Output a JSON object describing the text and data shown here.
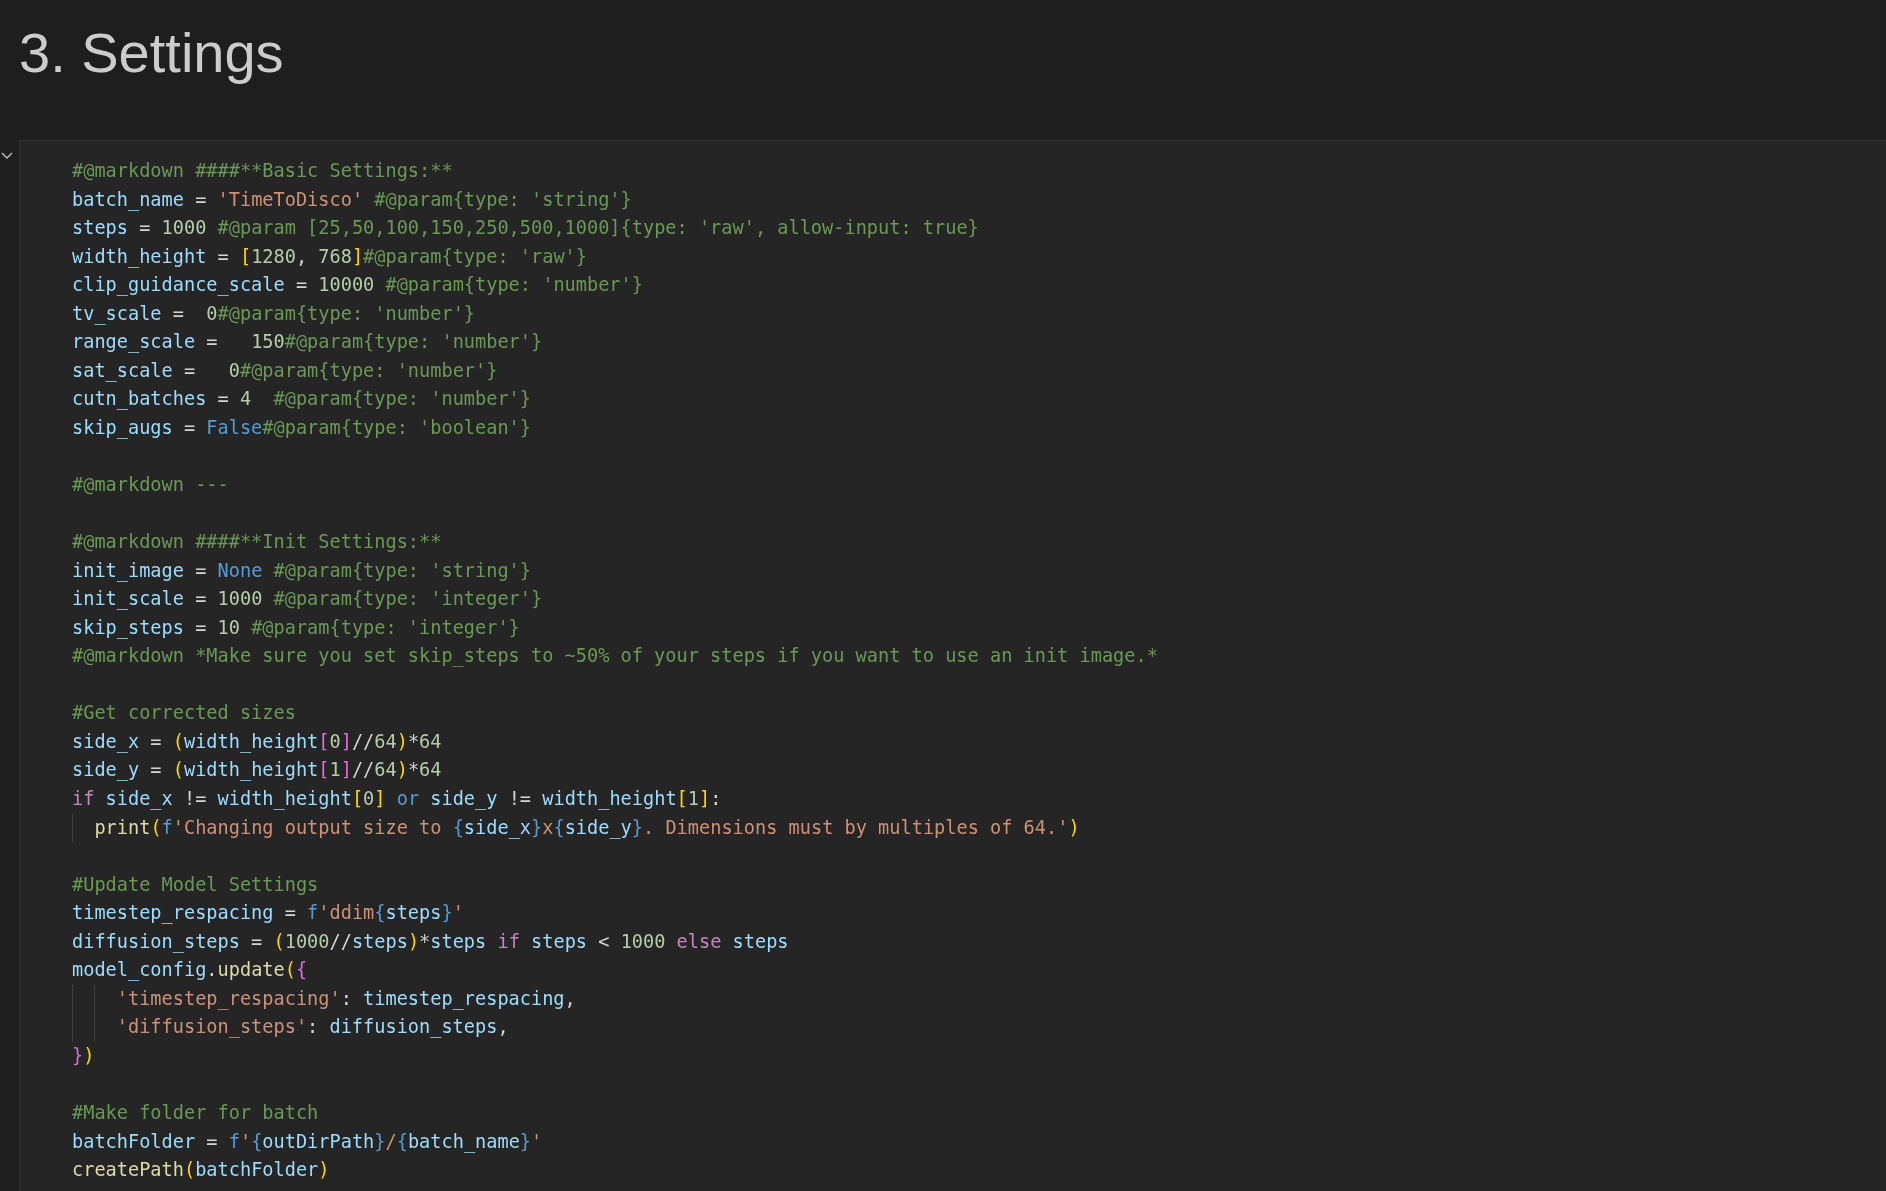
{
  "heading": "3. Settings",
  "cell": {
    "expanded": true,
    "lines": [
      {
        "kind": "code",
        "tokens": [
          {
            "text": "#@markdown ####**Basic Settings:**",
            "kind": "comment"
          }
        ]
      },
      {
        "kind": "code",
        "tokens": [
          {
            "text": "batch_name",
            "kind": "var"
          },
          {
            "text": " = ",
            "kind": "op"
          },
          {
            "text": "'TimeToDisco'",
            "kind": "str"
          },
          {
            "text": " #@param{type: 'string'}",
            "kind": "comment"
          }
        ]
      },
      {
        "kind": "code",
        "tokens": [
          {
            "text": "steps",
            "kind": "var"
          },
          {
            "text": " = ",
            "kind": "op"
          },
          {
            "text": "1000",
            "kind": "num"
          },
          {
            "text": " #@param [25,50,100,150,250,500,1000]{type: 'raw', allow-input: true}",
            "kind": "comment"
          }
        ]
      },
      {
        "kind": "code",
        "tokens": [
          {
            "text": "width_height",
            "kind": "var"
          },
          {
            "text": " = ",
            "kind": "op"
          },
          {
            "text": "[",
            "kind": "b1"
          },
          {
            "text": "1280",
            "kind": "num"
          },
          {
            "text": ", ",
            "kind": "op"
          },
          {
            "text": "768",
            "kind": "num"
          },
          {
            "text": "]",
            "kind": "b1"
          },
          {
            "text": "#@param{type: 'raw'}",
            "kind": "comment"
          }
        ]
      },
      {
        "kind": "code",
        "tokens": [
          {
            "text": "clip_guidance_scale",
            "kind": "var"
          },
          {
            "text": " = ",
            "kind": "op"
          },
          {
            "text": "10000",
            "kind": "num"
          },
          {
            "text": " #@param{type: 'number'}",
            "kind": "comment"
          }
        ]
      },
      {
        "kind": "code",
        "tokens": [
          {
            "text": "tv_scale",
            "kind": "var"
          },
          {
            "text": " =  ",
            "kind": "op"
          },
          {
            "text": "0",
            "kind": "num"
          },
          {
            "text": "#@param{type: 'number'}",
            "kind": "comment"
          }
        ]
      },
      {
        "kind": "code",
        "tokens": [
          {
            "text": "range_scale",
            "kind": "var"
          },
          {
            "text": " =   ",
            "kind": "op"
          },
          {
            "text": "150",
            "kind": "num"
          },
          {
            "text": "#@param{type: 'number'}",
            "kind": "comment"
          }
        ]
      },
      {
        "kind": "code",
        "tokens": [
          {
            "text": "sat_scale",
            "kind": "var"
          },
          {
            "text": " =   ",
            "kind": "op"
          },
          {
            "text": "0",
            "kind": "num"
          },
          {
            "text": "#@param{type: 'number'}",
            "kind": "comment"
          }
        ]
      },
      {
        "kind": "code",
        "tokens": [
          {
            "text": "cutn_batches",
            "kind": "var"
          },
          {
            "text": " = ",
            "kind": "op"
          },
          {
            "text": "4",
            "kind": "num"
          },
          {
            "text": "  #@param{type: 'number'}",
            "kind": "comment"
          }
        ]
      },
      {
        "kind": "code",
        "tokens": [
          {
            "text": "skip_augs",
            "kind": "var"
          },
          {
            "text": " = ",
            "kind": "op"
          },
          {
            "text": "False",
            "kind": "kw"
          },
          {
            "text": "#@param{type: 'boolean'}",
            "kind": "comment"
          }
        ]
      },
      {
        "kind": "blank"
      },
      {
        "kind": "code",
        "tokens": [
          {
            "text": "#@markdown ---",
            "kind": "comment"
          }
        ]
      },
      {
        "kind": "blank"
      },
      {
        "kind": "code",
        "tokens": [
          {
            "text": "#@markdown ####**Init Settings:**",
            "kind": "comment"
          }
        ]
      },
      {
        "kind": "code",
        "tokens": [
          {
            "text": "init_image",
            "kind": "var"
          },
          {
            "text": " = ",
            "kind": "op"
          },
          {
            "text": "None",
            "kind": "kw"
          },
          {
            "text": " #@param{type: 'string'}",
            "kind": "comment"
          }
        ]
      },
      {
        "kind": "code",
        "tokens": [
          {
            "text": "init_scale",
            "kind": "var"
          },
          {
            "text": " = ",
            "kind": "op"
          },
          {
            "text": "1000",
            "kind": "num"
          },
          {
            "text": " #@param{type: 'integer'}",
            "kind": "comment"
          }
        ]
      },
      {
        "kind": "code",
        "tokens": [
          {
            "text": "skip_steps",
            "kind": "var"
          },
          {
            "text": " = ",
            "kind": "op"
          },
          {
            "text": "10",
            "kind": "num"
          },
          {
            "text": " #@param{type: 'integer'}",
            "kind": "comment"
          }
        ]
      },
      {
        "kind": "code",
        "tokens": [
          {
            "text": "#@markdown *Make sure you set skip_steps to ~50% of your steps if you want to use an init image.*",
            "kind": "comment"
          }
        ]
      },
      {
        "kind": "blank"
      },
      {
        "kind": "code",
        "tokens": [
          {
            "text": "#Get corrected sizes",
            "kind": "comment"
          }
        ]
      },
      {
        "kind": "code",
        "tokens": [
          {
            "text": "side_x",
            "kind": "var"
          },
          {
            "text": " = ",
            "kind": "op"
          },
          {
            "text": "(",
            "kind": "b1"
          },
          {
            "text": "width_height",
            "kind": "var"
          },
          {
            "text": "[",
            "kind": "b2"
          },
          {
            "text": "0",
            "kind": "num"
          },
          {
            "text": "]",
            "kind": "b2"
          },
          {
            "text": "//",
            "kind": "op"
          },
          {
            "text": "64",
            "kind": "num"
          },
          {
            "text": ")",
            "kind": "b1"
          },
          {
            "text": "*",
            "kind": "op"
          },
          {
            "text": "64",
            "kind": "num"
          }
        ]
      },
      {
        "kind": "code",
        "tokens": [
          {
            "text": "side_y",
            "kind": "var"
          },
          {
            "text": " = ",
            "kind": "op"
          },
          {
            "text": "(",
            "kind": "b1"
          },
          {
            "text": "width_height",
            "kind": "var"
          },
          {
            "text": "[",
            "kind": "b2"
          },
          {
            "text": "1",
            "kind": "num"
          },
          {
            "text": "]",
            "kind": "b2"
          },
          {
            "text": "//",
            "kind": "op"
          },
          {
            "text": "64",
            "kind": "num"
          },
          {
            "text": ")",
            "kind": "b1"
          },
          {
            "text": "*",
            "kind": "op"
          },
          {
            "text": "64",
            "kind": "num"
          }
        ]
      },
      {
        "kind": "code",
        "tokens": [
          {
            "text": "if",
            "kind": "ctl"
          },
          {
            "text": " side_x",
            "kind": "var"
          },
          {
            "text": " != ",
            "kind": "op"
          },
          {
            "text": "width_height",
            "kind": "var"
          },
          {
            "text": "[",
            "kind": "b1"
          },
          {
            "text": "0",
            "kind": "num"
          },
          {
            "text": "]",
            "kind": "b1"
          },
          {
            "text": " or",
            "kind": "kw"
          },
          {
            "text": " side_y",
            "kind": "var"
          },
          {
            "text": " != ",
            "kind": "op"
          },
          {
            "text": "width_height",
            "kind": "var"
          },
          {
            "text": "[",
            "kind": "b1"
          },
          {
            "text": "1",
            "kind": "num"
          },
          {
            "text": "]",
            "kind": "b1"
          },
          {
            "text": ":",
            "kind": "op"
          }
        ],
        "children": [
          {
            "kind": "code",
            "tokens": [
              {
                "text": "print",
                "kind": "fn"
              },
              {
                "text": "(",
                "kind": "b1"
              },
              {
                "text": "f",
                "kind": "kw"
              },
              {
                "text": "'Changing output size to ",
                "kind": "str"
              },
              {
                "text": "{",
                "kind": "kw"
              },
              {
                "text": "side_x",
                "kind": "var"
              },
              {
                "text": "}",
                "kind": "kw"
              },
              {
                "text": "x",
                "kind": "str"
              },
              {
                "text": "{",
                "kind": "kw"
              },
              {
                "text": "side_y",
                "kind": "var"
              },
              {
                "text": "}",
                "kind": "kw"
              },
              {
                "text": ". Dimensions must by multiples of 64.'",
                "kind": "str"
              },
              {
                "text": ")",
                "kind": "b1"
              }
            ]
          }
        ]
      },
      {
        "kind": "blank"
      },
      {
        "kind": "code",
        "tokens": [
          {
            "text": "#Update Model Settings",
            "kind": "comment"
          }
        ]
      },
      {
        "kind": "code",
        "tokens": [
          {
            "text": "timestep_respacing",
            "kind": "var"
          },
          {
            "text": " = ",
            "kind": "op"
          },
          {
            "text": "f",
            "kind": "kw"
          },
          {
            "text": "'ddim",
            "kind": "str"
          },
          {
            "text": "{",
            "kind": "kw"
          },
          {
            "text": "steps",
            "kind": "var"
          },
          {
            "text": "}",
            "kind": "kw"
          },
          {
            "text": "'",
            "kind": "str"
          }
        ]
      },
      {
        "kind": "code",
        "tokens": [
          {
            "text": "diffusion_steps",
            "kind": "var"
          },
          {
            "text": " = ",
            "kind": "op"
          },
          {
            "text": "(",
            "kind": "b1"
          },
          {
            "text": "1000",
            "kind": "num"
          },
          {
            "text": "//",
            "kind": "op"
          },
          {
            "text": "steps",
            "kind": "var"
          },
          {
            "text": ")",
            "kind": "b1"
          },
          {
            "text": "*",
            "kind": "op"
          },
          {
            "text": "steps",
            "kind": "var"
          },
          {
            "text": " if",
            "kind": "ctl"
          },
          {
            "text": " steps",
            "kind": "var"
          },
          {
            "text": " < ",
            "kind": "op"
          },
          {
            "text": "1000",
            "kind": "num"
          },
          {
            "text": " else",
            "kind": "ctl"
          },
          {
            "text": " steps",
            "kind": "var"
          }
        ]
      },
      {
        "kind": "code",
        "tokens": [
          {
            "text": "model_config",
            "kind": "var"
          },
          {
            "text": ".",
            "kind": "op"
          },
          {
            "text": "update",
            "kind": "fn"
          },
          {
            "text": "(",
            "kind": "b1"
          },
          {
            "text": "{",
            "kind": "b2"
          }
        ],
        "children": [
          {
            "kind": "group",
            "children": [
              {
                "kind": "code",
                "tokens": [
                  {
                    "text": "'timestep_respacing'",
                    "kind": "str"
                  },
                  {
                    "text": ": ",
                    "kind": "op"
                  },
                  {
                    "text": "timestep_respacing",
                    "kind": "var"
                  },
                  {
                    "text": ",",
                    "kind": "op"
                  }
                ]
              },
              {
                "kind": "code",
                "tokens": [
                  {
                    "text": "'diffusion_steps'",
                    "kind": "str"
                  },
                  {
                    "text": ": ",
                    "kind": "op"
                  },
                  {
                    "text": "diffusion_steps",
                    "kind": "var"
                  },
                  {
                    "text": ",",
                    "kind": "op"
                  }
                ]
              }
            ]
          }
        ]
      },
      {
        "kind": "code",
        "tokens": [
          {
            "text": "}",
            "kind": "b2"
          },
          {
            "text": ")",
            "kind": "b1"
          }
        ]
      },
      {
        "kind": "blank"
      },
      {
        "kind": "code",
        "tokens": [
          {
            "text": "#Make folder for batch",
            "kind": "comment"
          }
        ]
      },
      {
        "kind": "code",
        "tokens": [
          {
            "text": "batchFolder",
            "kind": "var"
          },
          {
            "text": " = ",
            "kind": "op"
          },
          {
            "text": "f",
            "kind": "kw"
          },
          {
            "text": "'",
            "kind": "str"
          },
          {
            "text": "{",
            "kind": "kw"
          },
          {
            "text": "outDirPath",
            "kind": "var"
          },
          {
            "text": "}",
            "kind": "kw"
          },
          {
            "text": "/",
            "kind": "str"
          },
          {
            "text": "{",
            "kind": "kw"
          },
          {
            "text": "batch_name",
            "kind": "var"
          },
          {
            "text": "}",
            "kind": "kw"
          },
          {
            "text": "'",
            "kind": "str"
          }
        ]
      },
      {
        "kind": "code",
        "tokens": [
          {
            "text": "createPath",
            "kind": "fn"
          },
          {
            "text": "(",
            "kind": "b1"
          },
          {
            "text": "batchFolder",
            "kind": "var"
          },
          {
            "text": ")",
            "kind": "b1"
          }
        ]
      }
    ]
  }
}
